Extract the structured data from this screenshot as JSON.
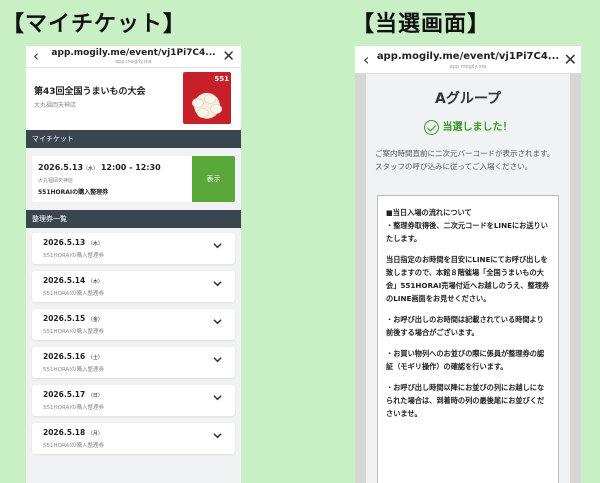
{
  "labels": {
    "left": "【マイチケット】",
    "right": "【当選画面】"
  },
  "left_phone": {
    "url": "app.mogily.me/event/vj1Pi7C4...",
    "url_sub": "app.mogily.me",
    "event_name": "第43回全国うまいもの大会",
    "event_place": "大丸福岡天神店",
    "event_image_text": "551",
    "myticket_header": "マイチケット",
    "myticket": {
      "date": "2026.5.13",
      "dow": "（水）",
      "time": "12:00 - 12:30",
      "place": "大丸福岡天神店",
      "kind": "551HORAIの購入整理券",
      "button": "表示"
    },
    "list_header": "整理券一覧",
    "tickets": [
      {
        "date": "2026.5.13",
        "dow": "（水）",
        "kind": "551HORAIの購入整理券"
      },
      {
        "date": "2026.5.14",
        "dow": "（木）",
        "kind": "551HORAIの購入整理券"
      },
      {
        "date": "2026.5.15",
        "dow": "（金）",
        "kind": "551HORAIの購入整理券"
      },
      {
        "date": "2026.5.16",
        "dow": "（土）",
        "kind": "551HORAIの購入整理券"
      },
      {
        "date": "2026.5.17",
        "dow": "（日）",
        "kind": "551HORAIの購入整理券"
      },
      {
        "date": "2026.5.18",
        "dow": "（月）",
        "kind": "551HORAIの購入整理券"
      }
    ],
    "icons": {
      "back": "chevron-left-icon",
      "close": "close-icon",
      "expand": "chevron-down-icon"
    }
  },
  "right_phone": {
    "url": "app.mogily.me/event/vj1Pi7C4...",
    "url_sub": "app.mogily.me",
    "group": "Aグループ",
    "result": "当選しました！",
    "notice": "ご案内時間直前に二次元バーコードが表示されます。スタッフの呼び込みに従ってご入場ください。",
    "flow_title": "■当日入場の流れについて",
    "flow_1": "・整理券取得後、二次元コードをLINEにお送りいたします。",
    "flow_2": "当日指定のお時間を目安にLINEにてお呼び出しを致しますので、本館８階催場「全国うまいもの大会」551HORAI売場付近へお越しのうえ、整理券のLINE画面をお見せください。",
    "flow_3": "・お呼び出しのお時間は記載されている時間より前後する場合がございます。",
    "flow_4": "・お買い物列へのお並びの際に係員が整理券の認証（モギリ操作）の確認を行います。",
    "flow_5": "・お呼び出し時間以降にお並びの列にお越しになられた場合は、到着時の列の最後尾にお並びくださいませ。"
  },
  "colors": {
    "background": "#c8f0c4",
    "dark_bar": "#3a4550",
    "show_button": "#5aa83a",
    "win_green": "#3a9a2a"
  }
}
